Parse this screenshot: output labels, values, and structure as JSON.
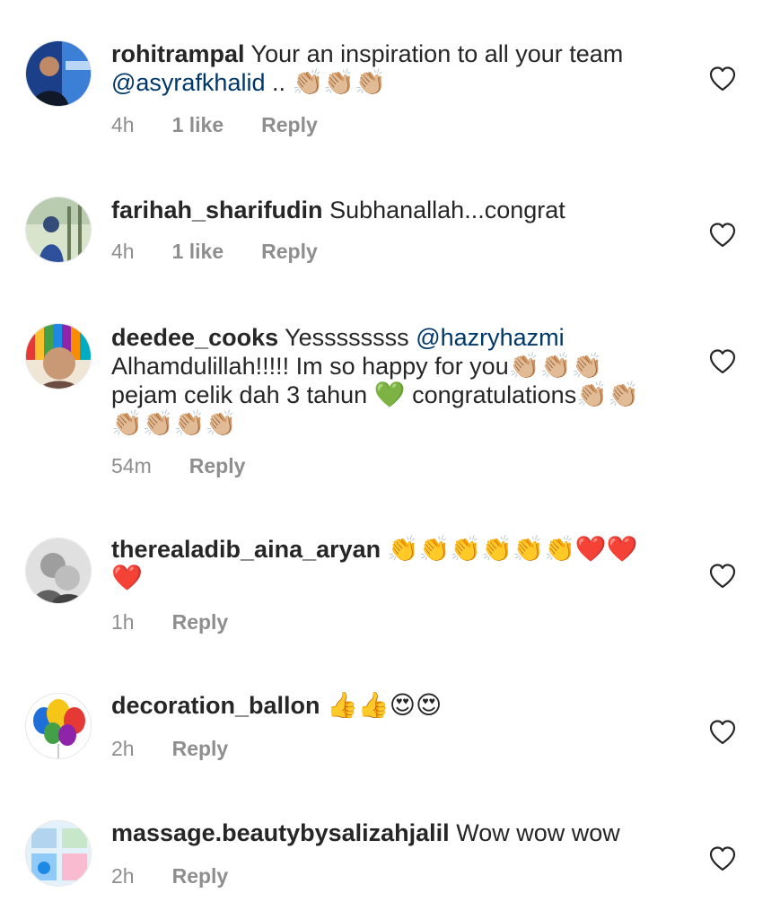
{
  "comments": [
    {
      "username": "rohitrampal",
      "text_before": "Your an inspiration to all your team ",
      "mention": "@asyrafkhalid",
      "text_after": " .. ",
      "emoji": "👏🏼👏🏼👏🏼",
      "time": "4h",
      "likes": "1 like",
      "reply": "Reply",
      "like_icon": "heart-outline-icon"
    },
    {
      "username": "farihah_sharifudin",
      "text_before": "Subhanallah...congrat",
      "time": "4h",
      "likes": "1 like",
      "reply": "Reply",
      "like_icon": "heart-outline-icon"
    },
    {
      "username": "deedee_cooks",
      "text_before": "Yessssssss ",
      "mention": "@hazryhazmi",
      "text_after": " Alhamdulillah!!!!! Im so happy for you",
      "emoji": "👏🏼👏🏼👏🏼",
      "text_after2": " pejam celik dah 3 tahun ",
      "emoji2": "💚",
      "text_after3": " congratulations",
      "emoji3": "👏🏼👏🏼👏🏼👏🏼👏🏼👏🏼",
      "time": "54m",
      "reply": "Reply",
      "like_icon": "heart-outline-icon"
    },
    {
      "username": "therealadib_aina_aryan",
      "emoji": "👏👏👏👏👏👏❤️❤️❤️",
      "time": "1h",
      "reply": "Reply",
      "like_icon": "heart-outline-icon"
    },
    {
      "username": "decoration_ballon",
      "emoji": "👍👍😍😍",
      "time": "2h",
      "reply": "Reply",
      "like_icon": "heart-outline-icon"
    },
    {
      "username": "massage.beautybysalizahjalil",
      "text_before": "Wow wow wow",
      "time": "2h",
      "reply": "Reply",
      "like_icon": "heart-outline-icon"
    }
  ],
  "colors": {
    "text": "#262626",
    "meta": "#8e8e8e",
    "mention": "#00376b",
    "background": "#ffffff"
  }
}
